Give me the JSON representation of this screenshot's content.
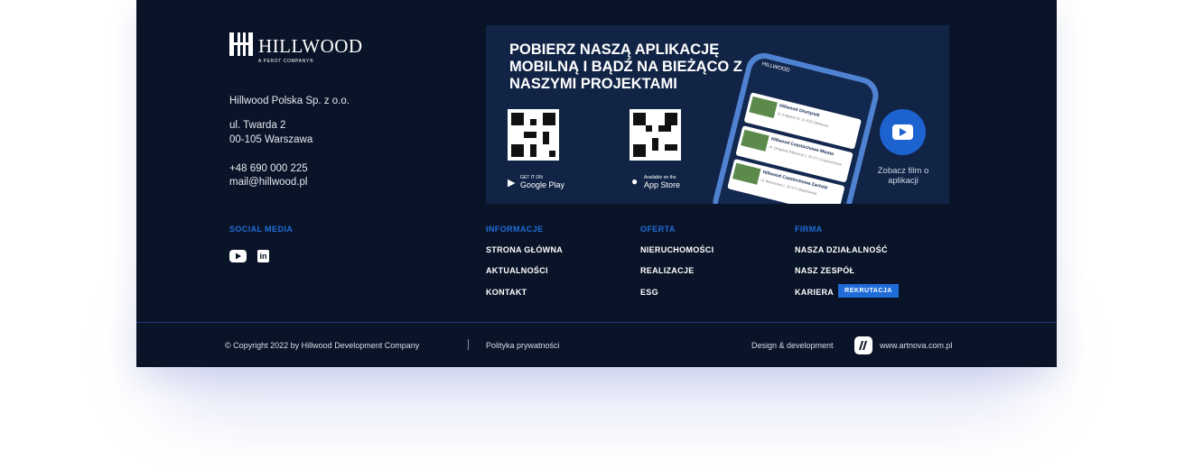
{
  "brand": {
    "name": "HILLWOOD",
    "tagline": "A PEROT COMPANY®"
  },
  "contact": {
    "company": "Hillwood Polska Sp. z o.o.",
    "street": "ul. Twarda 2",
    "city": "00-105 Warszawa",
    "phone": "+48 690 000 225",
    "email": "mail@hillwood.pl"
  },
  "social": {
    "title": "SOCIAL MEDIA",
    "icons": [
      "youtube-icon",
      "linkedin-icon"
    ]
  },
  "banner": {
    "title": "POBIERZ NASZĄ APLIKACJĘ MOBILNĄ I BĄDŹ NA BIEŻĄCO Z NASZYMI PROJEKTAMI",
    "google_small": "GET IT ON",
    "google": "Google Play",
    "apple_small": "Available on the",
    "apple": "App Store",
    "video_label": "Zobacz film o aplikacji",
    "phone_cards": [
      {
        "title": "Hillwood Olsztynek",
        "sub": "ul. Krajowa 20, 11-015 Olsztynek"
      },
      {
        "title": "Hillwood Częstochowa Miasto",
        "sub": "ul. Drogowa Północna 1, 42-271 Częstochowa"
      },
      {
        "title": "Hillwood Częstochowa Zachód",
        "sub": "ul. Wrzosowa 1, 42-271 Blachownia"
      }
    ]
  },
  "nav": {
    "informacje": {
      "title": "INFORMACJE",
      "links": [
        "STRONA GŁÓWNA",
        "AKTUALNOŚCI",
        "KONTAKT"
      ]
    },
    "oferta": {
      "title": "OFERTA",
      "links": [
        "NIERUCHOMOŚCI",
        "REALIZACJE",
        "ESG"
      ]
    },
    "firma": {
      "title": "FIRMA",
      "links": [
        "NASZA DZIAŁALNOŚĆ",
        "NASZ ZESPÓŁ",
        "KARIERA"
      ],
      "badge": "REKRUTACJA"
    }
  },
  "bottom": {
    "copyright": "© Copyright 2022 by Hillwood Development Company",
    "privacy": "Polityka prywatności",
    "design": "Design & development",
    "artnova": "www.artnova.com.pl"
  },
  "colors": {
    "background": "#0a1428",
    "banner": "#112446",
    "accent": "#1f6cd9"
  }
}
